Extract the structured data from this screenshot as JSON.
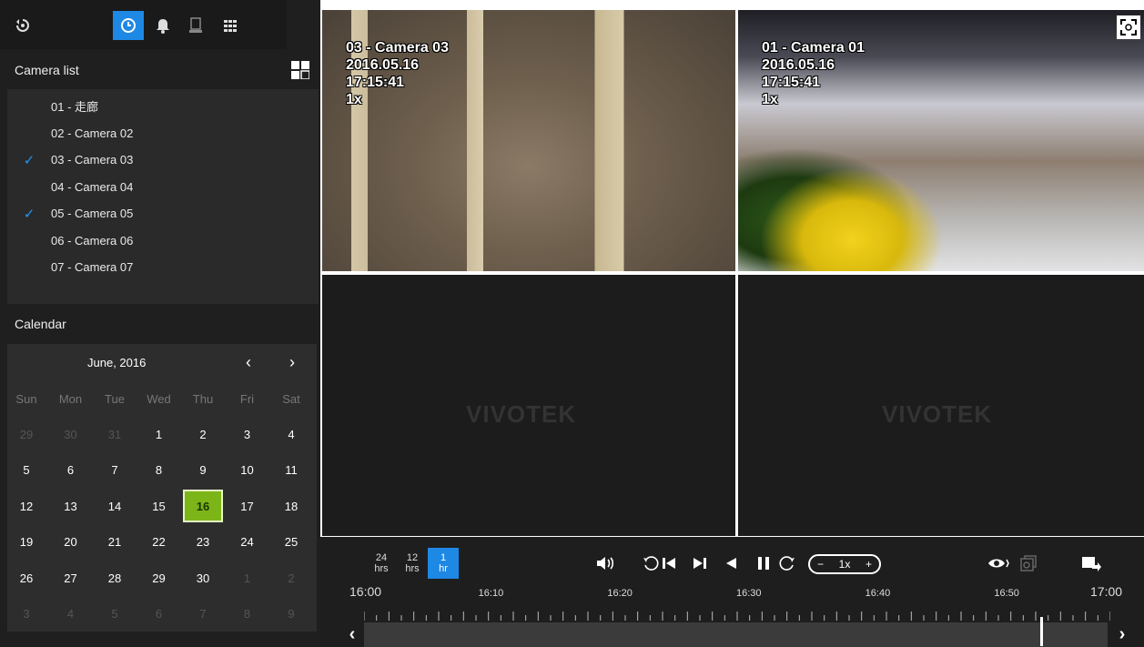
{
  "sidebar": {
    "camera_list_title": "Camera list",
    "cameras": [
      {
        "label": "01 - 走廊",
        "checked": false
      },
      {
        "label": "02 - Camera 02",
        "checked": false
      },
      {
        "label": "03 - Camera 03",
        "checked": true
      },
      {
        "label": "04 - Camera 04",
        "checked": false
      },
      {
        "label": "05 - Camera 05",
        "checked": true
      },
      {
        "label": "06 - Camera 06",
        "checked": false
      },
      {
        "label": "07 - Camera 07",
        "checked": false
      }
    ],
    "calendar_title": "Calendar",
    "calendar": {
      "month_label": "June, 2016",
      "prev": "‹",
      "next": "›",
      "weekdays": [
        "Sun",
        "Mon",
        "Tue",
        "Wed",
        "Thu",
        "Fri",
        "Sat"
      ],
      "selected_day": "16",
      "weeks": [
        [
          "29",
          "30",
          "31",
          "1",
          "2",
          "3",
          "4"
        ],
        [
          "5",
          "6",
          "7",
          "8",
          "9",
          "10",
          "11"
        ],
        [
          "12",
          "13",
          "14",
          "15",
          "16",
          "17",
          "18"
        ],
        [
          "19",
          "20",
          "21",
          "22",
          "23",
          "24",
          "25"
        ],
        [
          "26",
          "27",
          "28",
          "29",
          "30",
          "1",
          "2"
        ],
        [
          "3",
          "4",
          "5",
          "6",
          "7",
          "8",
          "9"
        ]
      ],
      "dim_cells": [
        [
          0,
          0
        ],
        [
          0,
          1
        ],
        [
          0,
          2
        ],
        [
          4,
          5
        ],
        [
          4,
          6
        ],
        [
          5,
          0
        ],
        [
          5,
          1
        ],
        [
          5,
          2
        ],
        [
          5,
          3
        ],
        [
          5,
          4
        ],
        [
          5,
          5
        ],
        [
          5,
          6
        ]
      ]
    }
  },
  "views": {
    "camera_a": {
      "line1": "03 - Camera 03",
      "line2": "2016.05.16",
      "line3": "17:15:41",
      "line4": "1x"
    },
    "camera_b": {
      "line1": "01 - Camera 01",
      "line2": "2016.05.16",
      "line3": "17:15:41",
      "line4": "1x"
    },
    "empty_logo": "VIVOTEK"
  },
  "timeline": {
    "ranges": [
      {
        "value": "24",
        "unit": "hrs",
        "selected": false
      },
      {
        "value": "12",
        "unit": "hrs",
        "selected": false
      },
      {
        "value": "1",
        "unit": "hr",
        "selected": true
      }
    ],
    "speed": {
      "minus": "−",
      "value": "1x",
      "plus": "+"
    },
    "ticks": [
      "16:00",
      "16:10",
      "16:20",
      "16:30",
      "16:40",
      "16:50",
      "17:00"
    ],
    "cursor_fraction": 0.91
  },
  "icons": {
    "logout": "logout-icon",
    "playback": "clock-icon",
    "alarm": "bell-icon",
    "device": "server-icon",
    "layout": "grid-icon"
  },
  "colors": {
    "accent": "#1e88e5",
    "selected_day": "#7cb518",
    "check": "#2196f3"
  }
}
